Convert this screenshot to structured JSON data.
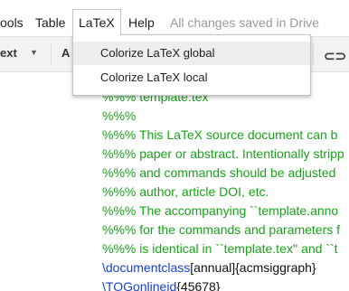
{
  "menubar": {
    "items": [
      "ools",
      "Table",
      "LaTeX",
      "Help"
    ],
    "status": "All changes saved in Drive"
  },
  "toolbar": {
    "style_label": "ext",
    "font_label": "A",
    "link_icon": "link-icon"
  },
  "dropdown": {
    "items": [
      "Colorize LaTeX global",
      "Colorize LaTeX local"
    ]
  },
  "document": {
    "lines": [
      {
        "type": "comment",
        "text": "%%% template.tex"
      },
      {
        "type": "comment",
        "text": "%%%"
      },
      {
        "type": "comment",
        "text": "%%% This LaTeX source document can b"
      },
      {
        "type": "comment",
        "text": "%%% paper or abstract. Intentionally stripp"
      },
      {
        "type": "comment",
        "text": "%%% and commands should be adjusted"
      },
      {
        "type": "comment",
        "text": "%%% author, article DOI, etc."
      },
      {
        "type": "comment",
        "text": "%%% The accompanying ``template.anno"
      },
      {
        "type": "comment",
        "text": "%%% for the commands and parameters f"
      },
      {
        "type": "comment",
        "text": "%%% is identical in ``template.tex'' and ``t"
      }
    ],
    "cmd_lines": [
      {
        "cmd": "\\documentclass",
        "opt": "[annual]",
        "arg": "{acmsiggraph}"
      },
      {
        "cmd": "\\TOGonlineid",
        "opt": "",
        "arg": "{45678}"
      }
    ]
  }
}
